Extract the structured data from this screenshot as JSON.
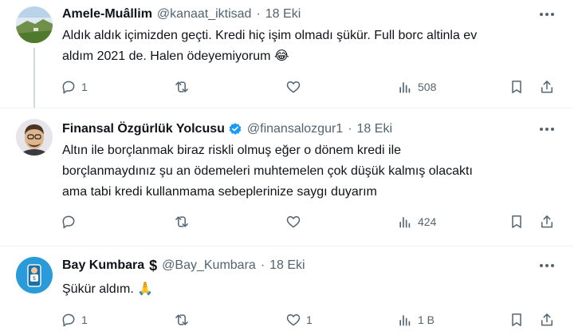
{
  "tweets": [
    {
      "name": "Amele-Muâllim",
      "handle": "@kanaat_iktisad",
      "dot": "·",
      "date": "18 Eki",
      "lines": [
        "Aldık aldık içimizden geçti. Kredi hiç işim olmadı şükür. Full borc altinla ev",
        "aldım 2021 de. Halen ödeyemiyorum 😂"
      ],
      "replies": "1",
      "retweets": "",
      "likes": "",
      "views": "508"
    },
    {
      "name": "Finansal Özgürlük Yolcusu",
      "handle": "@finansalozgur1",
      "dot": "·",
      "date": "18 Eki",
      "lines": [
        "Altın ile borçlanmak biraz riskli olmuş eğer o dönem kredi ile",
        "borçlanmaydınız şu an ödemeleri muhtemelen çok düşük kalmış olacaktı",
        "ama tabi kredi kullanmama sebeplerinize saygı duyarım"
      ],
      "replies": "",
      "retweets": "",
      "likes": "",
      "views": "424"
    },
    {
      "name": "Bay Kumbara",
      "name_suffix": "$",
      "handle": "@Bay_Kumbara",
      "dot": "·",
      "date": "18 Eki",
      "lines": [
        "Şükür aldım. 🙏"
      ],
      "replies": "1",
      "retweets": "",
      "likes": "1",
      "views": "1 B"
    }
  ],
  "colors": {
    "text": "#0f1419",
    "muted": "#536471",
    "verified": "#1d9bf0",
    "divider": "#eff3f4"
  },
  "icons": [
    "reply-icon",
    "retweet-icon",
    "like-icon",
    "views-icon",
    "bookmark-icon",
    "share-icon",
    "more-icon",
    "verified-badge-icon"
  ]
}
